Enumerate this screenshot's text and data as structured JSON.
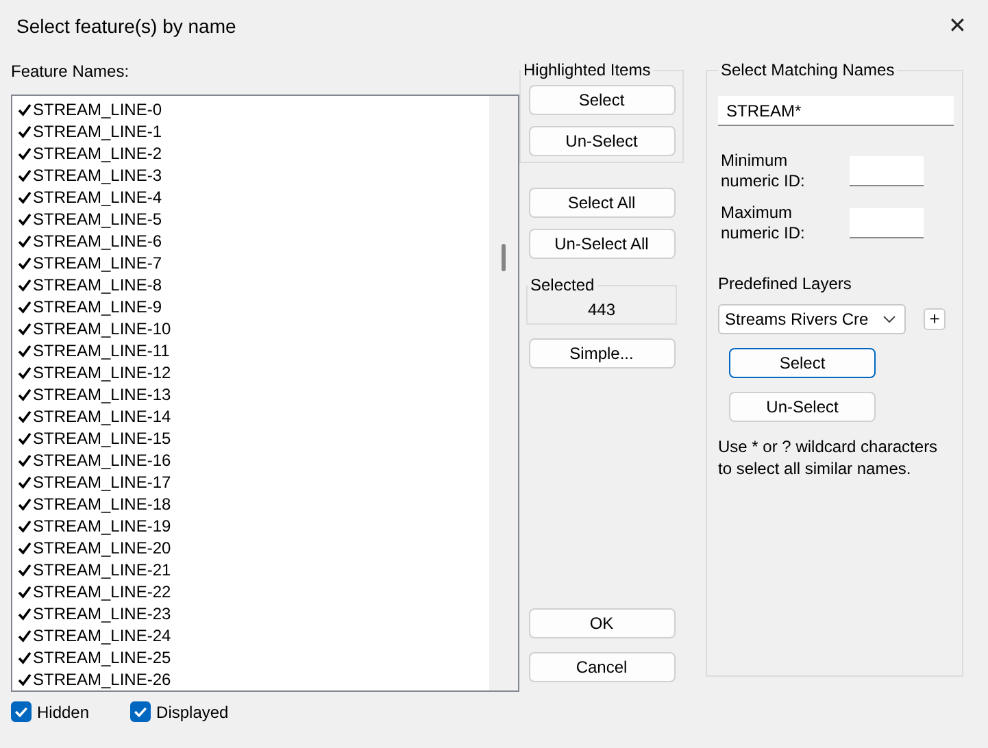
{
  "window": {
    "title": "Select feature(s) by name",
    "close": "✕"
  },
  "feature_list": {
    "label": "Feature Names:",
    "items": [
      {
        "name": "STREAM_LINE-0",
        "checked": true
      },
      {
        "name": "STREAM_LINE-1",
        "checked": true
      },
      {
        "name": "STREAM_LINE-2",
        "checked": true
      },
      {
        "name": "STREAM_LINE-3",
        "checked": true
      },
      {
        "name": "STREAM_LINE-4",
        "checked": true
      },
      {
        "name": "STREAM_LINE-5",
        "checked": true
      },
      {
        "name": "STREAM_LINE-6",
        "checked": true
      },
      {
        "name": "STREAM_LINE-7",
        "checked": true
      },
      {
        "name": "STREAM_LINE-8",
        "checked": true
      },
      {
        "name": "STREAM_LINE-9",
        "checked": true
      },
      {
        "name": "STREAM_LINE-10",
        "checked": true
      },
      {
        "name": "STREAM_LINE-11",
        "checked": true
      },
      {
        "name": "STREAM_LINE-12",
        "checked": true
      },
      {
        "name": "STREAM_LINE-13",
        "checked": true
      },
      {
        "name": "STREAM_LINE-14",
        "checked": true
      },
      {
        "name": "STREAM_LINE-15",
        "checked": true
      },
      {
        "name": "STREAM_LINE-16",
        "checked": true
      },
      {
        "name": "STREAM_LINE-17",
        "checked": true
      },
      {
        "name": "STREAM_LINE-18",
        "checked": true
      },
      {
        "name": "STREAM_LINE-19",
        "checked": true
      },
      {
        "name": "STREAM_LINE-20",
        "checked": true
      },
      {
        "name": "STREAM_LINE-21",
        "checked": true
      },
      {
        "name": "STREAM_LINE-22",
        "checked": true
      },
      {
        "name": "STREAM_LINE-23",
        "checked": true
      },
      {
        "name": "STREAM_LINE-24",
        "checked": true
      },
      {
        "name": "STREAM_LINE-25",
        "checked": true
      },
      {
        "name": "STREAM_LINE-26",
        "checked": true
      }
    ]
  },
  "highlighted_items": {
    "title": "Highlighted Items",
    "buttons": [
      "Select",
      "Un-Select"
    ]
  },
  "all_buttons": [
    "Select All",
    "Un-Select All"
  ],
  "selected": {
    "title": "Selected",
    "count": "443"
  },
  "simple_button": "Simple...",
  "dialog_buttons": [
    "OK",
    "Cancel"
  ],
  "matching": {
    "title": "Select Matching Names",
    "pattern": "STREAM*",
    "min_label": "Minimum numeric ID:",
    "max_label": "Maximum numeric ID:",
    "layers_label": "Predefined Layers",
    "layer_value": "Streams Rivers Cre",
    "add": "+",
    "buttons": [
      {
        "label": "Select",
        "focused": true
      },
      {
        "label": "Un-Select",
        "focused": false
      }
    ],
    "hint": "Use * or ? wildcard characters to select all similar names."
  },
  "options": [
    {
      "label": "Hidden",
      "checked": true
    },
    {
      "label": "Displayed",
      "checked": true
    }
  ]
}
